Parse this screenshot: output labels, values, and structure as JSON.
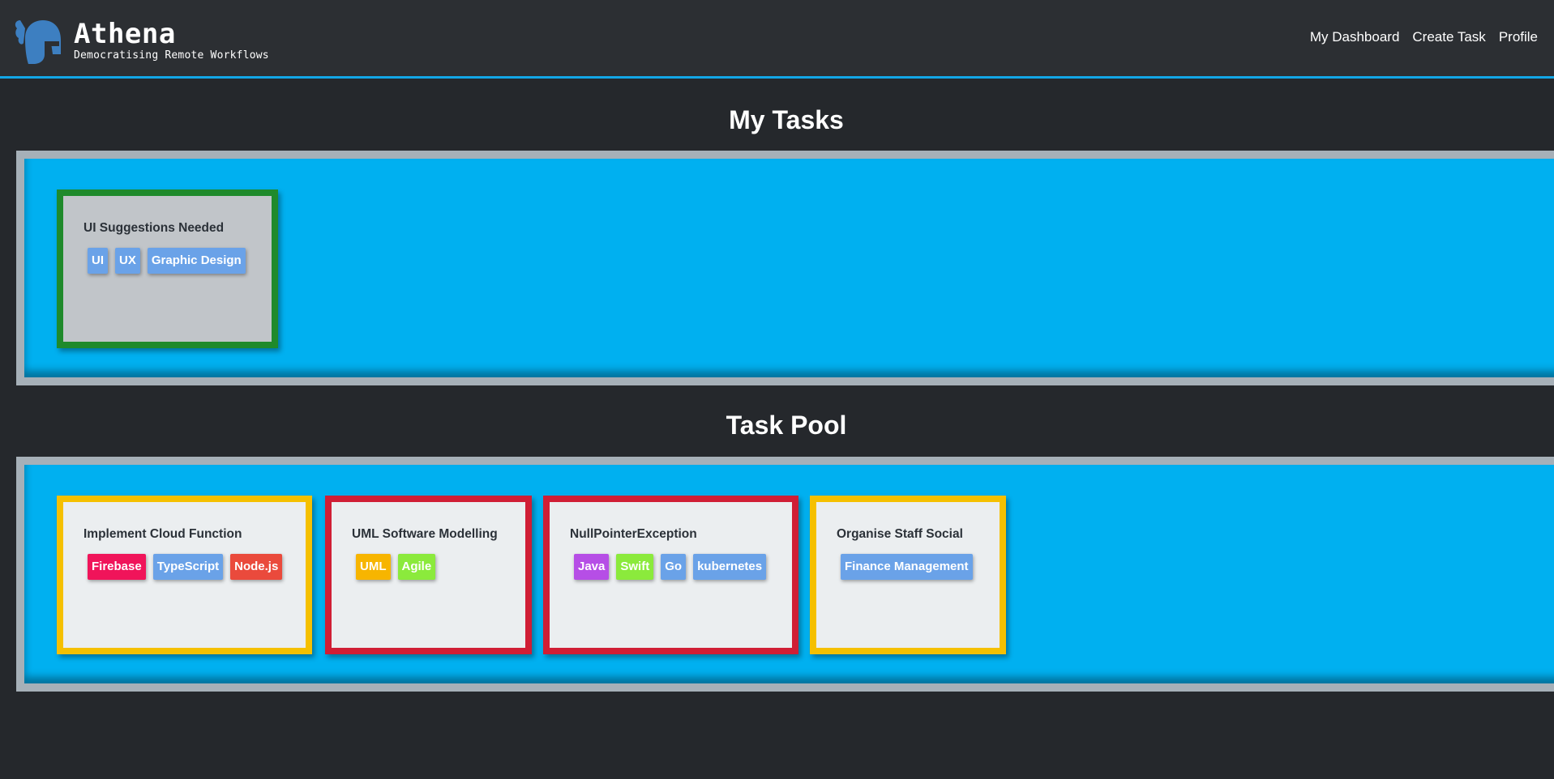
{
  "brand": {
    "title": "Athena",
    "subtitle": "Democratising Remote Workflows"
  },
  "nav": [
    "My Dashboard",
    "Create Task",
    "Profile"
  ],
  "sections": {
    "my_tasks": {
      "title": "My Tasks",
      "cards": [
        {
          "title": "UI Suggestions Needed",
          "border": "#1f8a2b",
          "tags": [
            {
              "label": "UI",
              "color": "#6aa2e8"
            },
            {
              "label": "UX",
              "color": "#6aa2e8"
            },
            {
              "label": "Graphic Design",
              "color": "#6aa2e8"
            }
          ]
        }
      ]
    },
    "task_pool": {
      "title": "Task Pool",
      "cards": [
        {
          "title": "Implement Cloud Function",
          "border": "#f5c000",
          "tags": [
            {
              "label": "Firebase",
              "color": "#f0145a"
            },
            {
              "label": "TypeScript",
              "color": "#6aa2e8"
            },
            {
              "label": "Node.js",
              "color": "#ea4a3c"
            }
          ]
        },
        {
          "title": "UML Software Modelling",
          "border": "#d01e35",
          "tags": [
            {
              "label": "UML",
              "color": "#f7b500"
            },
            {
              "label": "Agile",
              "color": "#8bea3c"
            }
          ]
        },
        {
          "title": "NullPointerException",
          "border": "#d01e35",
          "tags": [
            {
              "label": "Java",
              "color": "#b64ee6"
            },
            {
              "label": "Swift",
              "color": "#8bea3c"
            },
            {
              "label": "Go",
              "color": "#6aa2e8"
            },
            {
              "label": "kubernetes",
              "color": "#6aa2e8"
            }
          ]
        },
        {
          "title": "Organise Staff Social",
          "border": "#f5c000",
          "tags": [
            {
              "label": "Finance Management",
              "color": "#6aa2e8"
            }
          ]
        }
      ]
    }
  },
  "colors": {
    "accent": "#12a6e6",
    "board": "#00b0f0",
    "background": "#25282c"
  }
}
